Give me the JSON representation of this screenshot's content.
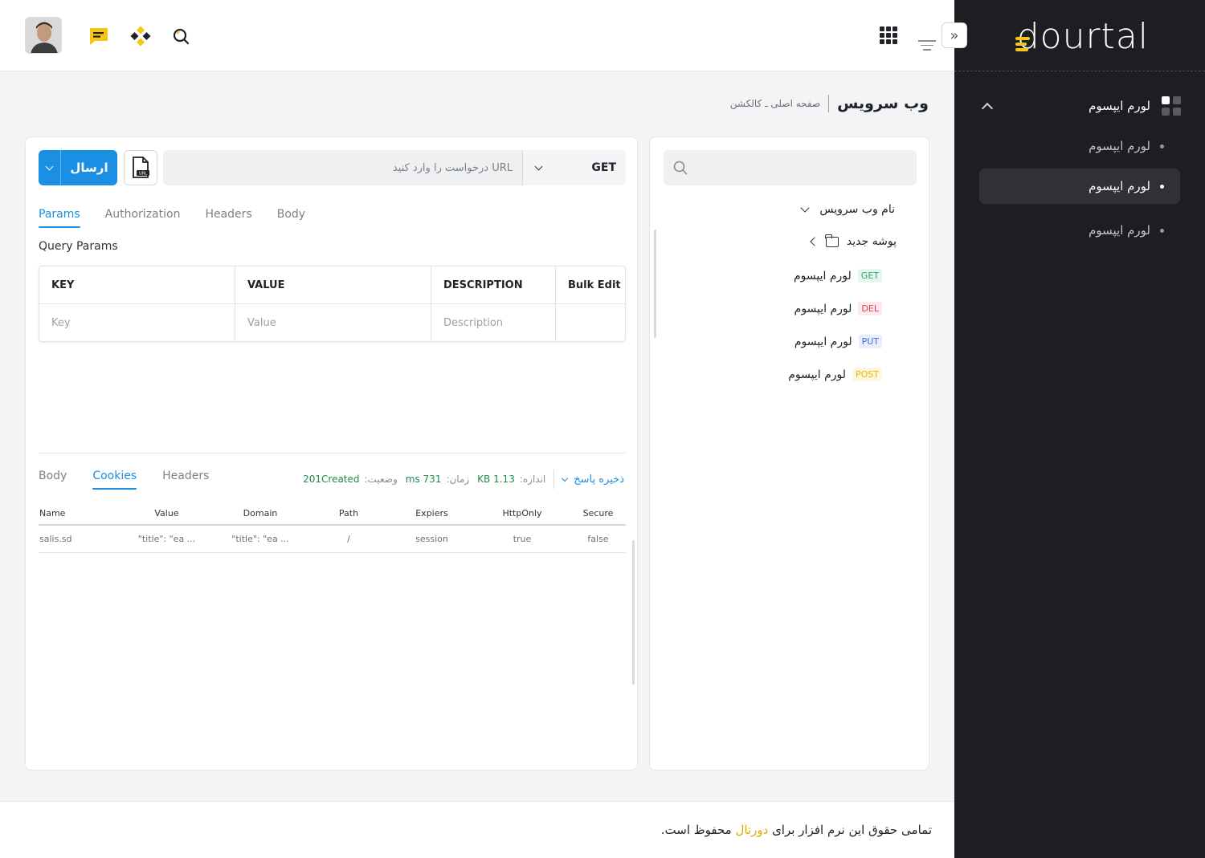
{
  "brand": {
    "logo_text": "dourtal",
    "accent": "#f5c518"
  },
  "sidebar": {
    "section_label": "لورم ایپسوم",
    "items": [
      {
        "label": "لورم ایپسوم",
        "active": false
      },
      {
        "label": "لورم ایپسوم",
        "active": true
      },
      {
        "label": "لورم ایپسوم",
        "active": false
      }
    ]
  },
  "header": {
    "page_title": "وب سرویس",
    "breadcrumb": "صفحه اصلی ـ کالکشن"
  },
  "collections": {
    "search_placeholder": "",
    "root_label": "نام وب سرویس",
    "folder_label": "پوشه جدید",
    "requests": [
      {
        "method": "GET",
        "label": "لورم ایپسوم",
        "color": "#2ea66b",
        "bg": "#e6f6ee"
      },
      {
        "method": "DEL",
        "label": "لورم ایپسوم",
        "color": "#e0455a",
        "bg": "#fde9ec"
      },
      {
        "method": "PUT",
        "label": "لورم ایپسوم",
        "color": "#3b6fd8",
        "bg": "#e8eefc"
      },
      {
        "method": "POST",
        "label": "لورم ایپسوم",
        "color": "#e6b800",
        "bg": "#fdf8df"
      }
    ]
  },
  "request": {
    "send_label": "ارسال",
    "method": "GET",
    "url_placeholder": "URL درخواست را وارد کنید",
    "tabs": [
      "Params",
      "Authorization",
      "Headers",
      "Body"
    ],
    "query_label": "Query Params",
    "params_headers": [
      "KEY",
      "VALUE",
      "DESCRIPTION",
      "Bulk Edit"
    ],
    "params_placeholders": [
      "Key",
      "Value",
      "Description",
      ""
    ]
  },
  "response": {
    "tabs": [
      "Body",
      "Cookies",
      "Headers"
    ],
    "save_label": "ذخیره پاسخ",
    "size_label": "اندازه:",
    "size_value": "1.13 KB",
    "time_label": "زمان:",
    "time_value": "731 ms",
    "status_label": "وضعیت:",
    "status_value": "201Created",
    "cookie_headers": [
      "Name",
      "Value",
      "Domain",
      "Path",
      "Expiers",
      "HttpOnly",
      "Secure"
    ],
    "cookie_rows": [
      [
        "salis.sd",
        "\"title\": \"ea   ...",
        "\"title\": \"ea   ...",
        "/",
        "session",
        "true",
        "false"
      ]
    ]
  },
  "footer": {
    "text_before": "تمامی حقوق این نرم افزار برای",
    "brand": "دورتال",
    "text_after": "محفوظ است."
  }
}
